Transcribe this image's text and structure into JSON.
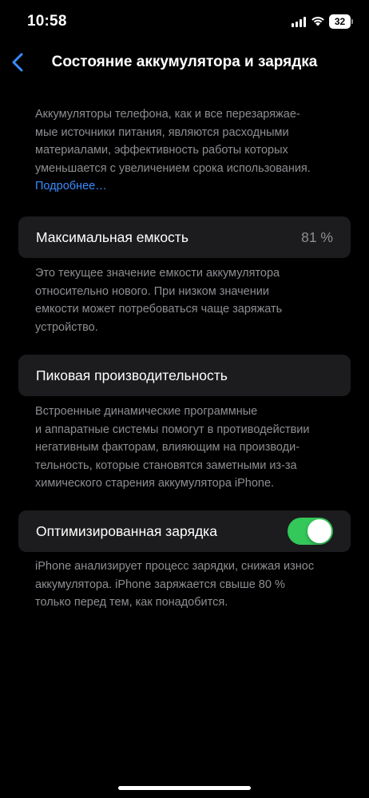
{
  "status_bar": {
    "time": "10:58",
    "battery_level": "32"
  },
  "nav": {
    "title": "Состояние аккумулятора и зарядка"
  },
  "intro": {
    "lines": [
      "Аккумуляторы телефона, как и все перезаряжае-",
      "мые источники питания, являются расходными",
      "материалами, эффективность работы которых",
      "уменьшается с увеличением срока использования."
    ],
    "link": "Подробнее…"
  },
  "max_capacity": {
    "label": "Максимальная емкость",
    "value": "81 %",
    "note_lines": [
      "Это текущее значение емкости аккумулятора",
      "относительно нового. При низком значении",
      "емкости может потребоваться чаще заряжать",
      "устройство."
    ]
  },
  "peak_performance": {
    "label": "Пиковая производительность",
    "note_lines": [
      "Встроенные динамические программные",
      "и аппаратные системы помогут в противодействии",
      "негативным факторам, влияющим на производи-",
      "тельность, которые становятся заметными из-за",
      "химического старения аккумулятора iPhone."
    ]
  },
  "optimized_charging": {
    "label": "Оптимизированная зарядка",
    "enabled": true,
    "note_lines": [
      "iPhone анализирует процесс зарядки, снижая износ",
      "аккумулятора. iPhone заряжается свыше 80 %",
      "только перед тем, как понадобится."
    ]
  },
  "colors": {
    "accent": "#3a8cff",
    "toggle_on": "#34c759",
    "card_bg": "#1c1c1e",
    "secondary_text": "#8e8e93"
  },
  "icons": {
    "back": "chevron-left-icon",
    "signal": "cellular-signal-icon",
    "wifi": "wifi-icon",
    "battery": "battery-icon"
  }
}
